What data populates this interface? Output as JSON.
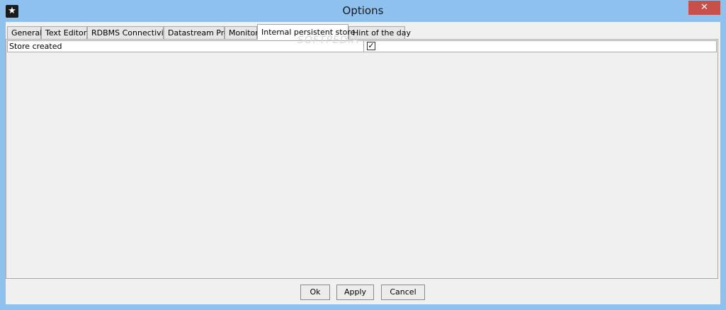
{
  "window": {
    "title": "Options",
    "close_glyph": "✕",
    "app_icon_glyph": "★"
  },
  "tabs": [
    {
      "label": "General"
    },
    {
      "label": "Text Editor"
    },
    {
      "label": "RDBMS Connectivity"
    },
    {
      "label": "Datastream Pro"
    },
    {
      "label": "Monitor"
    },
    {
      "label": "Internal persistent store",
      "active": true
    },
    {
      "label": "Hint of the day"
    }
  ],
  "panel": {
    "rows": [
      {
        "label": "Store created",
        "checked": true,
        "check_glyph": "✓"
      }
    ]
  },
  "buttons": {
    "ok": "Ok",
    "apply": "Apply",
    "cancel": "Cancel"
  },
  "watermark": "SOFTPEDIA"
}
